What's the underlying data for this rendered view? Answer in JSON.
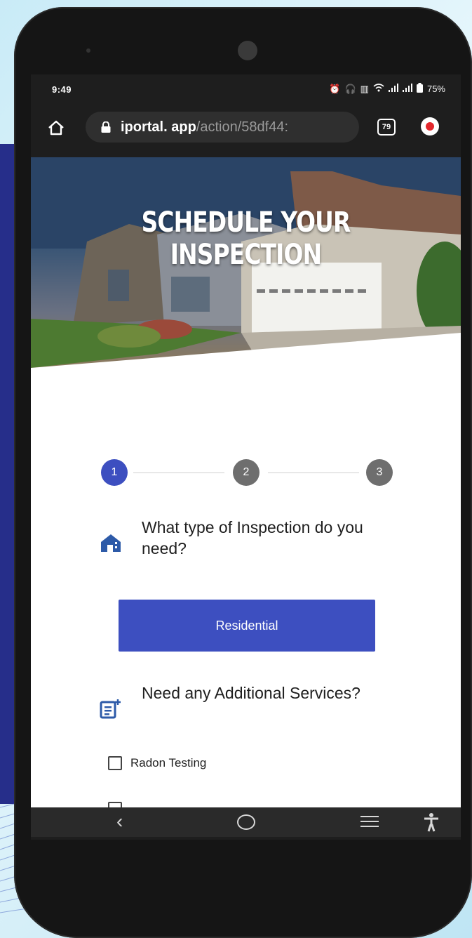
{
  "status_bar": {
    "time": "9:49",
    "battery": "75%"
  },
  "browser": {
    "url_domain": "iportal. app",
    "url_path": "/action/58df44:",
    "tab_count": "79"
  },
  "hero": {
    "title": "SCHEDULE YOUR INSPECTION"
  },
  "stepper": {
    "steps": [
      "1",
      "2",
      "3"
    ],
    "active_step": 1,
    "active_color": "#3d4fc0",
    "inactive_color": "#6e6e6e"
  },
  "inspection_question": {
    "text": "What type of Inspection do you need?",
    "icon": "house-icon"
  },
  "residential_button": {
    "label": "Residential",
    "color": "#3d4fc0"
  },
  "additional_services": {
    "heading": "Need any Additional Services?",
    "icon": "document-add-icon",
    "options": [
      {
        "label": "Radon Testing",
        "checked": false
      }
    ]
  },
  "nav_bar": {
    "buttons": [
      "back-icon",
      "home-circle-icon",
      "recents-menu-icon",
      "accessibility-icon"
    ]
  }
}
